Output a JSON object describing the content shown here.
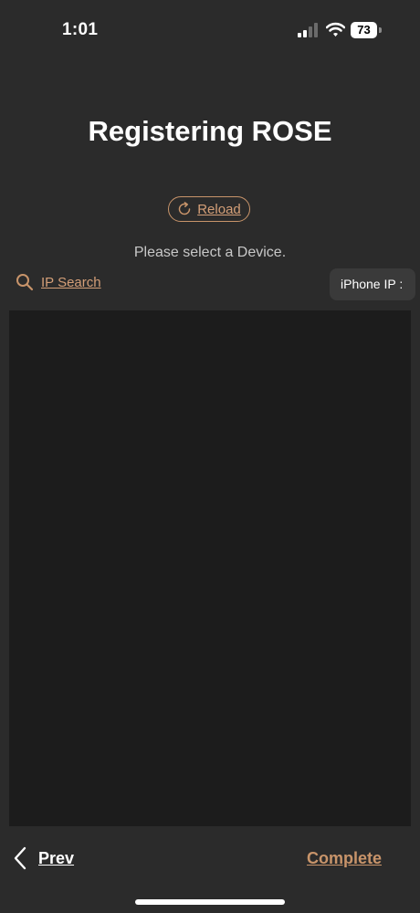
{
  "status_bar": {
    "time": "1:01",
    "battery": "73",
    "icons": [
      "cellular-signal-icon",
      "wifi-icon",
      "battery-icon"
    ]
  },
  "header": {
    "title": "Registering ROSE"
  },
  "reload": {
    "label": "Reload",
    "icon": "reload-icon"
  },
  "instruction": "Please select a Device.",
  "ip_search": {
    "label": "IP Search",
    "icon": "search-icon"
  },
  "iphone_ip": {
    "label": "iPhone IP :"
  },
  "footer": {
    "prev_label": "Prev",
    "complete_label": "Complete"
  },
  "colors": {
    "background": "#2b2b2b",
    "device_list_background": "#1c1c1c",
    "accent": "#c8946a",
    "text_primary": "#ffffff",
    "text_secondary": "#c8c8c8"
  }
}
